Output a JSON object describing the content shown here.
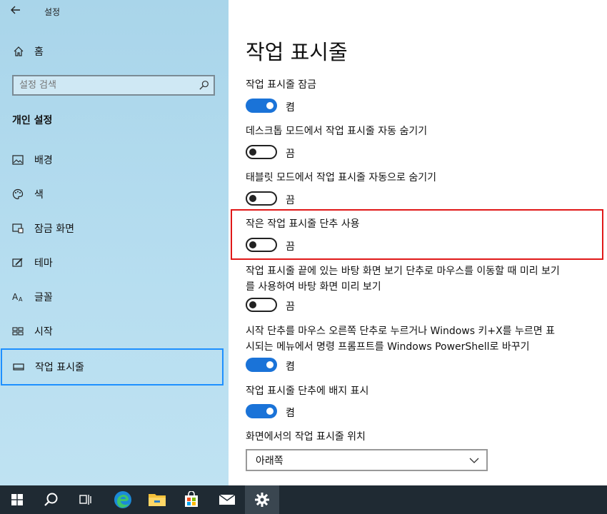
{
  "app": {
    "title": "설정"
  },
  "sidebar": {
    "home_label": "홈",
    "search_placeholder": "설정 검색",
    "section_title": "개인 설정",
    "items": [
      {
        "label": "배경",
        "icon": "picture-icon"
      },
      {
        "label": "색",
        "icon": "palette-icon"
      },
      {
        "label": "잠금 화면",
        "icon": "lock-screen-icon"
      },
      {
        "label": "테마",
        "icon": "theme-icon"
      },
      {
        "label": "글꼴",
        "icon": "font-icon"
      },
      {
        "label": "시작",
        "icon": "start-icon"
      },
      {
        "label": "작업 표시줄",
        "icon": "taskbar-icon",
        "selected": true
      }
    ]
  },
  "main": {
    "title": "작업 표시줄",
    "settings": [
      {
        "label": "작업 표시줄 잠금",
        "state": "켬",
        "on": true
      },
      {
        "label": "데스크톱 모드에서 작업 표시줄 자동 숨기기",
        "state": "끔",
        "on": false
      },
      {
        "label": "태블릿 모드에서 작업 표시줄 자동으로 숨기기",
        "state": "끔",
        "on": false
      },
      {
        "label": "작은 작업 표시줄 단추 사용",
        "state": "끔",
        "on": false
      },
      {
        "label": "작업 표시줄 끝에 있는 바탕 화면 보기 단추로 마우스를 이동할 때 미리 보기를 사용하여 바탕 화면 미리 보기",
        "state": "끔",
        "on": false
      },
      {
        "label": "시작 단추를 마우스 오른쪽 단추로 누르거나 Windows 키+X를 누르면 표시되는 메뉴에서 명령 프롬프트를 Windows PowerShell로 바꾸기",
        "state": "켬",
        "on": true
      },
      {
        "label": "작업 표시줄 단추에 배지 표시",
        "state": "켬",
        "on": true
      }
    ],
    "position_label": "화면에서의 작업 표시줄 위치",
    "position_value": "아래쪽"
  },
  "colors": {
    "accent": "#1a73d8",
    "highlight": "#e01818",
    "selection": "#1e90ff",
    "taskbar": "#1f2a33"
  },
  "taskbar": [
    "start-icon",
    "search-icon",
    "task-view-icon",
    "edge-icon",
    "file-explorer-icon",
    "store-icon",
    "mail-icon",
    "settings-icon"
  ]
}
